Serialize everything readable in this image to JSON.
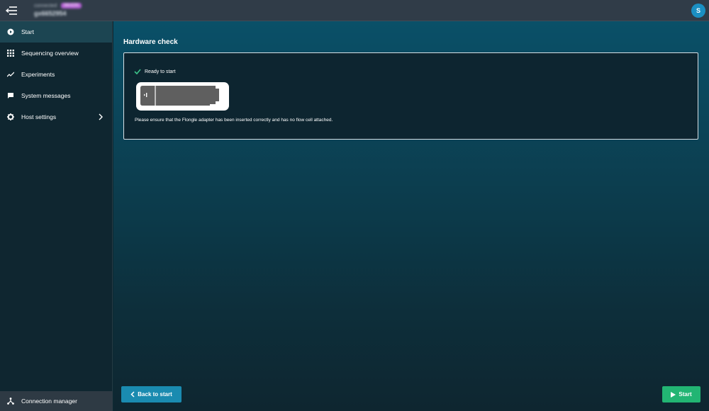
{
  "header": {
    "device_small_text": "connected",
    "device_badge": "MinION",
    "device_name": "gx6652954",
    "user_initial": "S"
  },
  "sidebar": {
    "items": [
      {
        "label": "Start",
        "icon": "play-circle-icon",
        "active": true
      },
      {
        "label": "Sequencing overview",
        "icon": "grid-icon",
        "active": false
      },
      {
        "label": "Experiments",
        "icon": "trend-line-icon",
        "active": false
      },
      {
        "label": "System messages",
        "icon": "message-icon",
        "active": false
      },
      {
        "label": "Host settings",
        "icon": "gear-icon",
        "active": false,
        "has_submenu": true
      }
    ],
    "footer": {
      "label": "Connection manager",
      "icon": "network-icon"
    }
  },
  "main": {
    "title": "Hardware check",
    "card": {
      "status_text": "Ready to start",
      "status_icon": "check-icon",
      "device_image": "flongle-adapter-icon",
      "note": "Please ensure that the Flongle adapter has been inserted correctly and has no flow cell attached."
    },
    "back_button": "Back to start",
    "start_button": "Start"
  },
  "colors": {
    "topbar": "#303c48",
    "sidebar": "#0f2630",
    "active_item": "#1c4552",
    "accent_blue": "#1a8bb0",
    "accent_green": "#22b573",
    "check_green": "#3cc48a"
  }
}
